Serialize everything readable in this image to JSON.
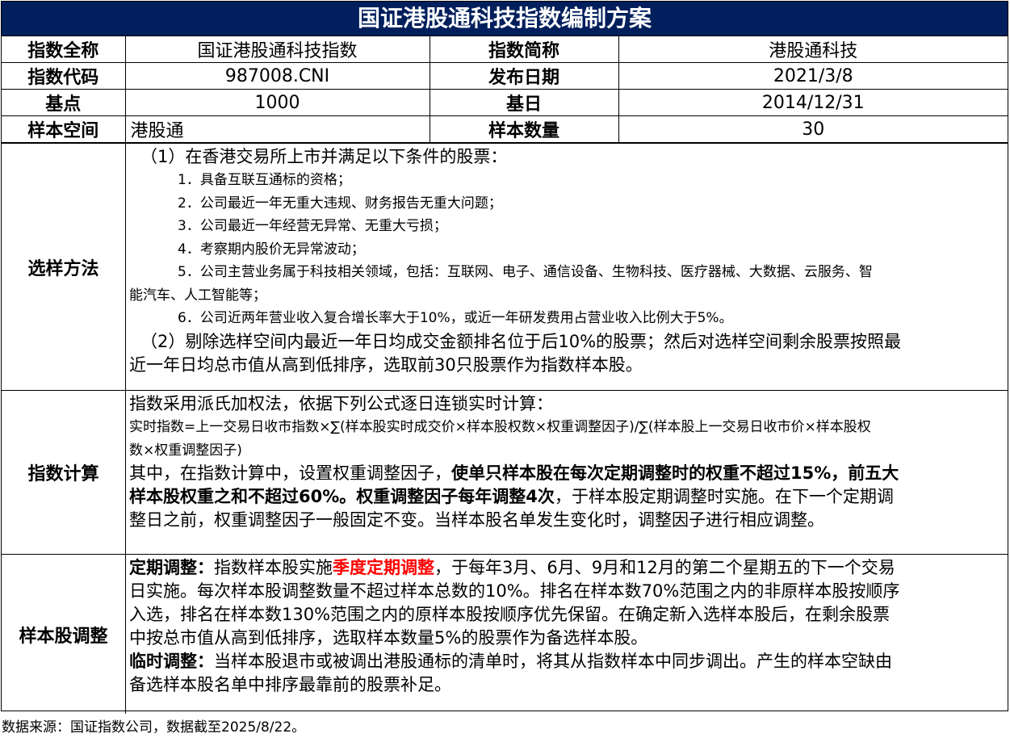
{
  "title": "国证港股通科技指数编制方案",
  "info": {
    "full_name_label": "指数全称",
    "full_name": "国证港股通科技指数",
    "short_name_label": "指数简称",
    "short_name": "港股通科技",
    "code_label": "指数代码",
    "code": "987008.CNI",
    "release_date_label": "发布日期",
    "release_date": "2021/3/8",
    "base_point_label": "基点",
    "base_point": "1000",
    "base_date_label": "基日",
    "base_date": "2014/12/31",
    "universe_label": "样本空间",
    "universe": "港股通",
    "count_label": "样本数量",
    "count": "30"
  },
  "selection": {
    "label": "选样方法",
    "item1": "（1）在香港交易所上市并满足以下条件的股票：",
    "c1": "1．具备互联互通标的资格；",
    "c2": "2．公司最近一年无重大违规、财务报告无重大问题；",
    "c3": "3．公司最近一年经营无异常、无重大亏损；",
    "c4": "4．考察期内股价无异常波动；",
    "c5a": "5．公司主营业务属于科技相关领域，包括：互联网、电子、通信设备、生物科技、医疗器械、大数据、云服务、智",
    "c5b": "能汽车、人工智能等；",
    "c6": "6．公司近两年营业收入复合增长率大于10%，或近一年研发费用占营业收入比例大于5%。",
    "item2a": "（2）剔除选样空间内最近一年日均成交金额排名位于后10%的股票；然后对选样空间剩余股票按照最",
    "item2b": "近一年日均总市值从高到低排序，选取前30只股票作为指数样本股。"
  },
  "calculation": {
    "label": "指数计算",
    "line1": "指数采用派氏加权法，依据下列公式逐日连锁实时计算：",
    "formula_a": "实时指数=上一交易日收市指数×∑(样本股实时成交价×样本股权数×权重调整因子)/∑(样本股上一交易日收市价×样本股权",
    "formula_b": "数×权重调整因子)",
    "p1_pre": "其中，在指数计算中，设置权重调整因子，",
    "p1_bold": "使单只样本股在每次定期调整时的权重不超过15%，前五大",
    "p2_bold": "样本股权重之和不超过60%。权重调整因子每年调整4次",
    "p2_post": "，于样本股定期调整时实施。在下一个定期调",
    "p3": "整日之前，权重调整因子一般固定不变。当样本股名单发生变化时，调整因子进行相应调整。"
  },
  "adjustment": {
    "label": "样本股调整",
    "reg_label": "定期调整：",
    "reg_pre": "指数样本股实施",
    "reg_red": "季度定期调整",
    "reg_post": "，于每年3月、6月、9月和12月的第二个星期五的下一个交易",
    "l2": "日实施。每次样本股调整数量不超过样本总数的10%。排名在样本数70%范围之内的非原样本股按顺序",
    "l3": "入选，排名在样本数130%范围之内的原样本股按顺序优先保留。在确定新入选样本股后，在剩余股票",
    "l4": "中按总市值从高到低排序，选取样本数量5%的股票作为备选样本股。",
    "tmp_label": "临时调整：",
    "tmp_a": "当样本股退市或被调出港股通标的清单时，将其从指数样本中同步调出。产生的样本空缺由",
    "tmp_b": "备选样本股名单中排序最靠前的股票补足。"
  },
  "footer": "数据来源：国证指数公司，数据截至2025/8/22。"
}
